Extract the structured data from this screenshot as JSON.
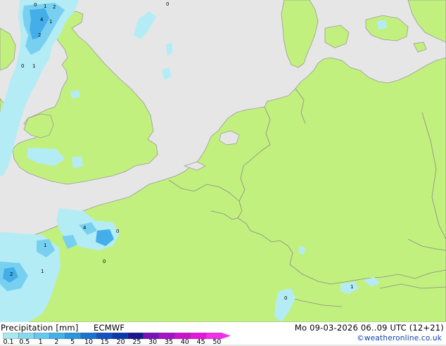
{
  "footer": {
    "title": "Precipitation [mm]",
    "model": "ECMWF",
    "valid_time": "Mo 09-03-2026 06..09 UTC (12+21)",
    "copyright": "©weatheronline.co.uk"
  },
  "legend": {
    "ticks": [
      "0.1",
      "0.5",
      "1",
      "2",
      "5",
      "10",
      "15",
      "20",
      "25",
      "30",
      "35",
      "40",
      "45",
      "50"
    ],
    "colors": [
      "#a9e8f0",
      "#8ad8ee",
      "#68c8ec",
      "#44b0e6",
      "#2a96dc",
      "#1a74cf",
      "#1352c0",
      "#0c38aa",
      "#1a1890",
      "#7a12b8",
      "#a612c8",
      "#cc14d0",
      "#e418dc",
      "#f030e8"
    ]
  },
  "colors": {
    "sea": "#e6e6e6",
    "land": "#c2f07e",
    "border": "#8a8a8a",
    "coast": "#9a9a9a",
    "precip_light": "#b4ecf6",
    "precip_medium": "#78d0f0",
    "precip_heavy": "#44aee8"
  },
  "precip_labels": [
    "0",
    "1",
    "2",
    "4",
    "1",
    "2",
    "0",
    "1",
    "4",
    "0",
    "0",
    "1",
    "2",
    "1",
    "0",
    "1",
    "0"
  ]
}
